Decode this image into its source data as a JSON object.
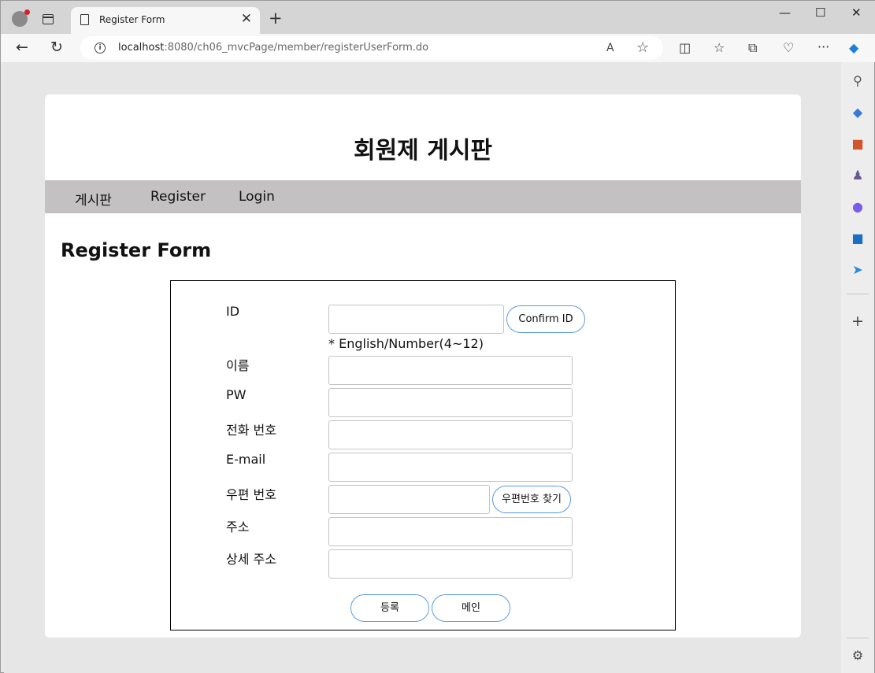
{
  "browser": {
    "tab_title": "Register Form",
    "tab_close": "✕",
    "new_tab": "+",
    "url_host": "localhost",
    "url_rest": ":8080/ch06_mvcPage/member/registerUserForm.do",
    "back": "←",
    "reload": "↻",
    "read_aloud": "A",
    "favorite": "☆",
    "minimize": "—",
    "maximize": "☐",
    "close": "✕",
    "more": "···"
  },
  "site": {
    "title": "회원제 게시판",
    "menu": [
      "게시판",
      "Register",
      "Login"
    ]
  },
  "page_heading": "Register Form",
  "form": {
    "fields": {
      "id": "ID",
      "name": "이름",
      "pw": "PW",
      "phone": "전화 번호",
      "email": "E-mail",
      "zipcode": "우편 번호",
      "address": "주소",
      "address_detail": "상세 주소"
    },
    "values": {
      "id": "",
      "name": "",
      "pw": "",
      "phone": "",
      "email": "",
      "zipcode": "",
      "address": "",
      "address_detail": ""
    },
    "id_hint": "* English/Number(4~12)",
    "confirm_id_label": "Confirm ID",
    "find_zipcode_label": "우편번호 찾기",
    "submit_label": "등록",
    "main_label": "메인"
  },
  "colors": {
    "menubar": "#c3c1c1",
    "button_border": "#5a9be0"
  }
}
